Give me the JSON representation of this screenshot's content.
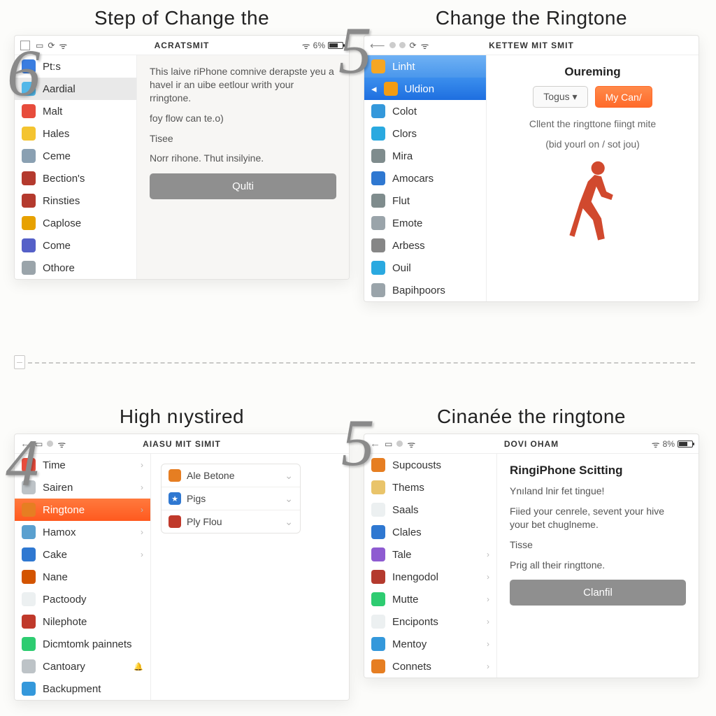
{
  "steps": {
    "top_left": {
      "number": "6",
      "title": "Step of Change the",
      "status": {
        "center": "ACRATSMIT",
        "right_pct": "6%"
      },
      "sidebar": [
        {
          "label": "Pt:s",
          "icon": "letter-a-icon",
          "color": "#3a7de0"
        },
        {
          "label": "Aardial",
          "icon": "globe-icon",
          "color": "#52b7e8",
          "selected": "gray"
        },
        {
          "label": "Malt",
          "icon": "doc-icon",
          "color": "#e74c3c"
        },
        {
          "label": "Hales",
          "icon": "face-icon",
          "color": "#f4c430"
        },
        {
          "label": "Ceme",
          "icon": "grid-icon",
          "color": "#8aa0b2"
        },
        {
          "label": "Bection's",
          "icon": "square-icon",
          "color": "#b43a2e"
        },
        {
          "label": "Rinsties",
          "icon": "square-icon",
          "color": "#b43a2e"
        },
        {
          "label": "Caplose",
          "icon": "star-icon",
          "color": "#e7a100"
        },
        {
          "label": "Come",
          "icon": "app-icon",
          "color": "#5560c8"
        },
        {
          "label": "Othore",
          "icon": "misc-icon",
          "color": "#9aa4aa"
        }
      ],
      "content": {
        "p1": "This laive riPhone comnive derapste yeu a havel ir an uibe eetlour writh your rringtone.",
        "p2": "foy flow can te.o)",
        "p3": "Tisee",
        "p4": "Norr rihone. Thut insilyine.",
        "button": "Qulti"
      }
    },
    "top_right": {
      "number": "5",
      "title": "Change the Ringtone",
      "status": {
        "center": "KETTEW MIT SMIT"
      },
      "sidebar": [
        {
          "label": "Linht",
          "icon": "folder-icon",
          "color": "#f5a623",
          "selected": "blue-light"
        },
        {
          "label": "Uldion",
          "icon": "card-icon",
          "color": "#f39c12",
          "selected": "blue",
          "back_chevron": true
        },
        {
          "label": "Colot",
          "icon": "mail-icon",
          "color": "#3498db"
        },
        {
          "label": "Clors",
          "icon": "palette-icon",
          "color": "#2aa9e0"
        },
        {
          "label": "Mira",
          "icon": "compass-icon",
          "color": "#7f8c8d"
        },
        {
          "label": "Amocars",
          "icon": "arrow-icon",
          "color": "#2f78d1"
        },
        {
          "label": "Flut",
          "icon": "bubble-icon",
          "color": "#7f8c8d"
        },
        {
          "label": "Emote",
          "icon": "emote-icon",
          "color": "#9aa4aa"
        },
        {
          "label": "Arbess",
          "icon": "gear-icon",
          "color": "#868686"
        },
        {
          "label": "Ouil",
          "icon": "bird-icon",
          "color": "#2aa9e0"
        },
        {
          "label": "Bapihpoors",
          "icon": "misc-icon",
          "color": "#9aa4aa"
        }
      ],
      "content": {
        "heading": "Oureming",
        "pill_left": "Togus",
        "pill_right": "My Can/",
        "line1": "Cllent the ringttone fiingt mite",
        "line2": "(bid yourl on / sot jou)"
      }
    },
    "bottom_left": {
      "number": "4",
      "title": "High nıystired",
      "status": {
        "center": "AIASU MIT SIMIT"
      },
      "sidebar": [
        {
          "label": "Time",
          "icon": "number-icon",
          "color": "#e74c3c",
          "chev": true
        },
        {
          "label": "Sairen",
          "icon": "doc-icon",
          "color": "#bdc3c7",
          "chev": true
        },
        {
          "label": "Ringtone",
          "icon": "music-icon",
          "color": "#e67e22",
          "chev": true,
          "selected": "orange"
        },
        {
          "label": "Hamox",
          "icon": "number-icon",
          "color": "#5aa0cf",
          "chev": true
        },
        {
          "label": "Cake",
          "icon": "number-icon",
          "color": "#2f78d1",
          "chev": true
        },
        {
          "label": "Nane",
          "icon": "globe-icon",
          "color": "#d35400"
        },
        {
          "label": "Pactoody",
          "icon": "blank-icon",
          "color": "#ecf0f1"
        },
        {
          "label": "Nilephote",
          "icon": "plus-icon",
          "color": "#c0392b"
        },
        {
          "label": "Dicmtomk painnets",
          "icon": "chat-icon",
          "color": "#2ecc71"
        },
        {
          "label": "Cantoary",
          "icon": "bell-icon",
          "color": "#bdc3c7",
          "bell": true
        },
        {
          "label": "Backupment",
          "icon": "cloud-icon",
          "color": "#3498db"
        }
      ],
      "subpanel": [
        {
          "label": "Ale Betone",
          "color": "#e67e22"
        },
        {
          "label": "Pigs",
          "color": "#2f78d1",
          "star": true
        },
        {
          "label": "Ply Flou",
          "color": "#c0392b"
        }
      ]
    },
    "bottom_right": {
      "number": "5",
      "title": "Cinanée the ringtone",
      "status": {
        "center": "DOVI OHAM",
        "right_pct": "8%"
      },
      "sidebar": [
        {
          "label": "Supcousts",
          "icon": "bag-icon",
          "color": "#e67e22"
        },
        {
          "label": "Thems",
          "icon": "list-icon",
          "color": "#e9c46a"
        },
        {
          "label": "Saals",
          "icon": "blank-icon",
          "color": "#ecf0f1"
        },
        {
          "label": "Clales",
          "icon": "s-icon",
          "color": "#2f78d1"
        },
        {
          "label": "Tale",
          "icon": "app-icon",
          "color": "#8e5bd1",
          "chev": true
        },
        {
          "label": "Inengodol",
          "icon": "square-icon",
          "color": "#b43a2e",
          "chev": true
        },
        {
          "label": "Mutte",
          "icon": "chat-icon",
          "color": "#2ecc71",
          "chev": true
        },
        {
          "label": "Enciponts",
          "icon": "blank-icon",
          "color": "#ecf0f1",
          "chev": true
        },
        {
          "label": "Mentoy",
          "icon": "globe-icon",
          "color": "#3498db",
          "chev": true
        },
        {
          "label": "Connets",
          "icon": "grid-icon",
          "color": "#e67e22",
          "chev": true
        }
      ],
      "content": {
        "heading": "RingiPhone Scitting",
        "p1": "Ynıland lnir fet tingue!",
        "p2": "Fiied your cenrele, sevent your hive your bet chuglneme.",
        "p3": "Tisse",
        "p4": "Prig all their ringttone.",
        "button": "Clanfil"
      }
    }
  }
}
